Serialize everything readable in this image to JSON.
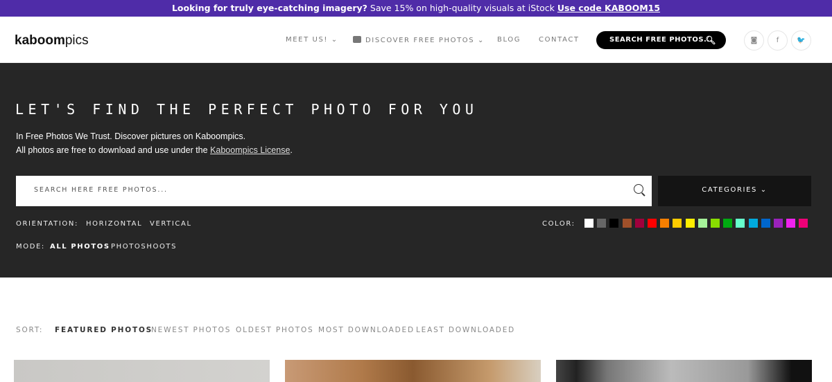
{
  "banner": {
    "bold": "Looking for truly eye-catching imagery?",
    "text": " Save 15% on high-quality visuals at iStock ",
    "code": "Use code KABOOM15"
  },
  "header": {
    "logo_bold": "kaboom",
    "logo_light": "pics",
    "nav": [
      "MEET US! ⌄",
      "DISCOVER FREE PHOTOS ⌄",
      "BLOG",
      "CONTACT"
    ],
    "search_label": "SEARCH FREE PHOTOS...",
    "social": [
      "instagram-icon",
      "facebook-icon",
      "twitter-icon"
    ],
    "social_glyphs": [
      "◙",
      "f",
      "🐦"
    ]
  },
  "hero": {
    "title": "LET'S FIND THE PERFECT PHOTO FOR YOU",
    "line1": "In Free Photos We Trust. Discover pictures on Kaboompics.",
    "line2_pre": "All photos are free to download and use under the ",
    "license_link": "Kaboompics License",
    "line2_post": ".",
    "search_placeholder": "SEARCH HERE FREE PHOTOS...",
    "categories": "CATEGORIES ⌄",
    "orientation_label": "ORIENTATION:",
    "orientation": [
      "HORIZONTAL",
      "VERTICAL"
    ],
    "mode_label": "MODE:",
    "modes": [
      "ALL PHOTOS",
      "PHOTOSHOOTS"
    ],
    "color_label": "COLOR:",
    "colors": [
      "#ffffff",
      "#666666",
      "#000000",
      "#a0502a",
      "#a0003c",
      "#ff0000",
      "#f77f00",
      "#ffcc00",
      "#ffee00",
      "#a6f29a",
      "#88dd00",
      "#00aa11",
      "#66ffcc",
      "#00aadd",
      "#0066cc",
      "#9922bb",
      "#ee22ee",
      "#ee0077"
    ]
  },
  "sort": {
    "label": "SORT:",
    "options": [
      "FEATURED PHOTOS",
      "NEWEST PHOTOS",
      "OLDEST PHOTOS",
      "MOST DOWNLOADED",
      "LEAST DOWNLOADED"
    ],
    "active": "FEATURED PHOTOS"
  },
  "accent": "#4f2ca8"
}
